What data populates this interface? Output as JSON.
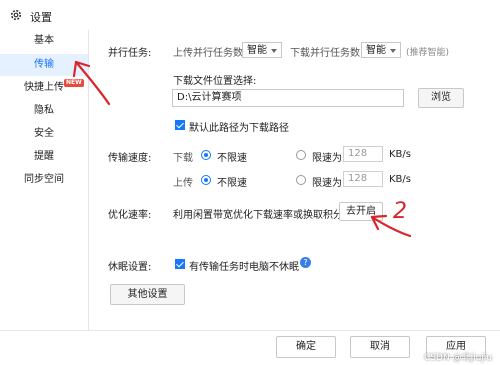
{
  "window": {
    "title": "设置"
  },
  "sidebar": {
    "items": [
      {
        "label": "基本",
        "active": false
      },
      {
        "label": "传输",
        "active": true
      },
      {
        "label": "快捷上传",
        "active": false,
        "badge": "NEW"
      },
      {
        "label": "隐私",
        "active": false
      },
      {
        "label": "安全",
        "active": false
      },
      {
        "label": "提醒",
        "active": false
      },
      {
        "label": "同步空间",
        "active": false
      }
    ]
  },
  "parallel": {
    "label": "并行任务:",
    "upload_label": "上传并行任务数",
    "upload_value": "智能",
    "download_label": "下载并行任务数",
    "download_value": "智能",
    "hint": "(推荐智能)"
  },
  "download_location": {
    "label": "下载文件位置选择:",
    "path": "D:\\云计算赛项",
    "browse_button": "浏览",
    "default_checkbox_label": "默认此路径为下载路径",
    "default_checked": true
  },
  "speed": {
    "label": "传输速度:",
    "download": {
      "label": "下载",
      "unlimited_label": "不限速",
      "limit_label": "限速为",
      "value": "128",
      "unit": "KB/s",
      "selected": "unlimited"
    },
    "upload": {
      "label": "上传",
      "unlimited_label": "不限速",
      "limit_label": "限速为",
      "value": "128",
      "unit": "KB/s",
      "selected": "unlimited"
    }
  },
  "optimize": {
    "label": "优化速率:",
    "text": "利用闲置带宽优化下载速率或换取积分",
    "button": "去开启"
  },
  "sleep": {
    "label": "休眠设置:",
    "checkbox_label": "有传输任务时电脑不休眠",
    "checked": true,
    "help": "?"
  },
  "other_settings_button": "其他设置",
  "footer": {
    "ok": "确定",
    "cancel": "取消",
    "apply": "应用",
    "watermark": "CSDN @北jiujiu"
  },
  "annotation": {
    "number": "2"
  },
  "colors": {
    "accent": "#1677ff",
    "annotation": "#d8262b",
    "active_bg": "#e6f1ff"
  }
}
